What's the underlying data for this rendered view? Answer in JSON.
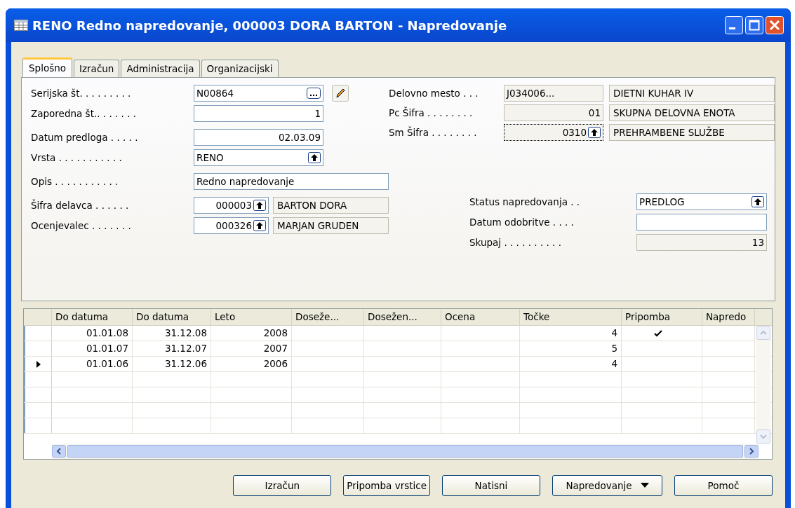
{
  "window": {
    "title": "RENO Redno napredovanje, 000003 DORA BARTON - Napredovanje"
  },
  "tabs": [
    {
      "label": "Splošno",
      "selected": true
    },
    {
      "label": "Izračun",
      "selected": false
    },
    {
      "label": "Administracija",
      "selected": false
    },
    {
      "label": "Organizacijski",
      "selected": false
    }
  ],
  "left_fields": [
    {
      "label": "Serijska št. . . . . . . . .",
      "value": "N00864",
      "right_aligned": false,
      "ellipsis": true,
      "lookup": false,
      "assist_edit": true,
      "editable": true,
      "wide": false
    },
    {
      "label": "Zaporedna št.. . . . . . .",
      "value": "1",
      "right_aligned": true,
      "ellipsis": false,
      "lookup": false,
      "assist_edit": false,
      "editable": true,
      "wide": false
    },
    {
      "label": "Datum predloga . . . . .",
      "value": "02.03.09",
      "right_aligned": true,
      "ellipsis": false,
      "lookup": false,
      "assist_edit": false,
      "editable": true,
      "wide": false
    },
    {
      "label": "Vrsta . . . . . . . . . . .",
      "value": "RENO",
      "right_aligned": false,
      "ellipsis": false,
      "lookup": true,
      "assist_edit": false,
      "editable": true,
      "wide": false
    },
    {
      "label": "Opis . . . . . . . . . . .",
      "value": "Redno napredovanje",
      "right_aligned": false,
      "ellipsis": false,
      "lookup": false,
      "assist_edit": false,
      "editable": true,
      "wide": true
    },
    {
      "label": "Šifra delavca . . . . . .",
      "value": "000003",
      "right_aligned": true,
      "ellipsis": false,
      "lookup": true,
      "assist_edit": false,
      "editable": true,
      "wide": false,
      "description": "BARTON DORA"
    },
    {
      "label": "Ocenjevalec . . . . . . .",
      "value": "000326",
      "right_aligned": true,
      "ellipsis": false,
      "lookup": true,
      "assist_edit": false,
      "editable": true,
      "wide": false,
      "description": "MARJAN GRUDEN"
    }
  ],
  "right_fields": [
    {
      "label": "Delovno mesto . . .",
      "value": "J034006...",
      "right_aligned": false,
      "lookup": false,
      "editable": false,
      "focused": false,
      "description": "DIETNI KUHAR IV"
    },
    {
      "label": "Pc Šifra . . . . . . . .",
      "value": "01",
      "right_aligned": true,
      "lookup": false,
      "editable": false,
      "focused": false,
      "description": "SKUPNA DELOVNA ENOTA"
    },
    {
      "label": "Sm Šifra . . . . . . . .",
      "value": "0310",
      "right_aligned": true,
      "lookup": true,
      "editable": false,
      "focused": true,
      "description": "PREHRAMBENE SLUŽBE"
    }
  ],
  "status_fields": [
    {
      "label": "Status napredovanja . .",
      "value": "PREDLOG",
      "right_aligned": false,
      "lookup": true,
      "editable": true
    },
    {
      "label": "Datum odobritve . . . .",
      "right_aligned": false,
      "lookup": false,
      "editable": true
    },
    {
      "label": "Skupaj . . . . . . . . . .",
      "value": "13",
      "right_aligned": true,
      "lookup": false,
      "editable": false
    }
  ],
  "table": {
    "columns": [
      "Do datuma",
      "Do datuma",
      "Leto",
      "Doseže...",
      "Dosežen...",
      "Ocena",
      "Točke",
      "Pripomba",
      "Napredo"
    ],
    "rows": [
      {
        "selected": false,
        "cells": [
          "01.01.08",
          "31.12.08",
          "2008",
          "",
          "",
          "",
          "4"
        ],
        "remark": true
      },
      {
        "selected": false,
        "cells": [
          "01.01.07",
          "31.12.07",
          "2007",
          "",
          "",
          "",
          "5"
        ],
        "remark": false
      },
      {
        "selected": true,
        "cells": [
          "01.01.06",
          "31.12.06",
          "2006",
          "",
          "",
          "",
          "4"
        ],
        "remark": false
      }
    ]
  },
  "buttons": [
    {
      "label": "Izračun",
      "menu": false
    },
    {
      "label": "Pripomba vrstice",
      "menu": false
    },
    {
      "label": "Natisni",
      "menu": false
    },
    {
      "label": "Napredovanje",
      "menu": true
    },
    {
      "label": "Pomoč",
      "menu": false
    }
  ]
}
